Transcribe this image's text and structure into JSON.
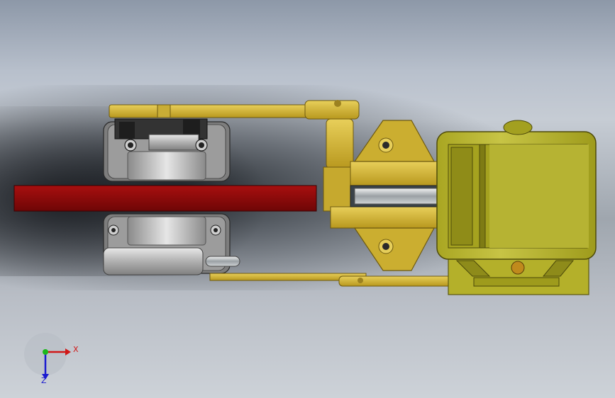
{
  "window": {
    "title": ""
  },
  "triad": {
    "x_label": "X",
    "z_label": "Z",
    "colors": {
      "x": "#d01818",
      "y": "#1cb81c",
      "z": "#1a1ad0"
    }
  },
  "colors": {
    "brass": "#d2b43a",
    "brass_dark": "#8e7418",
    "motor": "#b9b536",
    "motor_dark": "#6e6a14",
    "belt": "#8c0b0b",
    "steel": "#b8b8b8",
    "steel_dark": "#5a5a5a"
  }
}
